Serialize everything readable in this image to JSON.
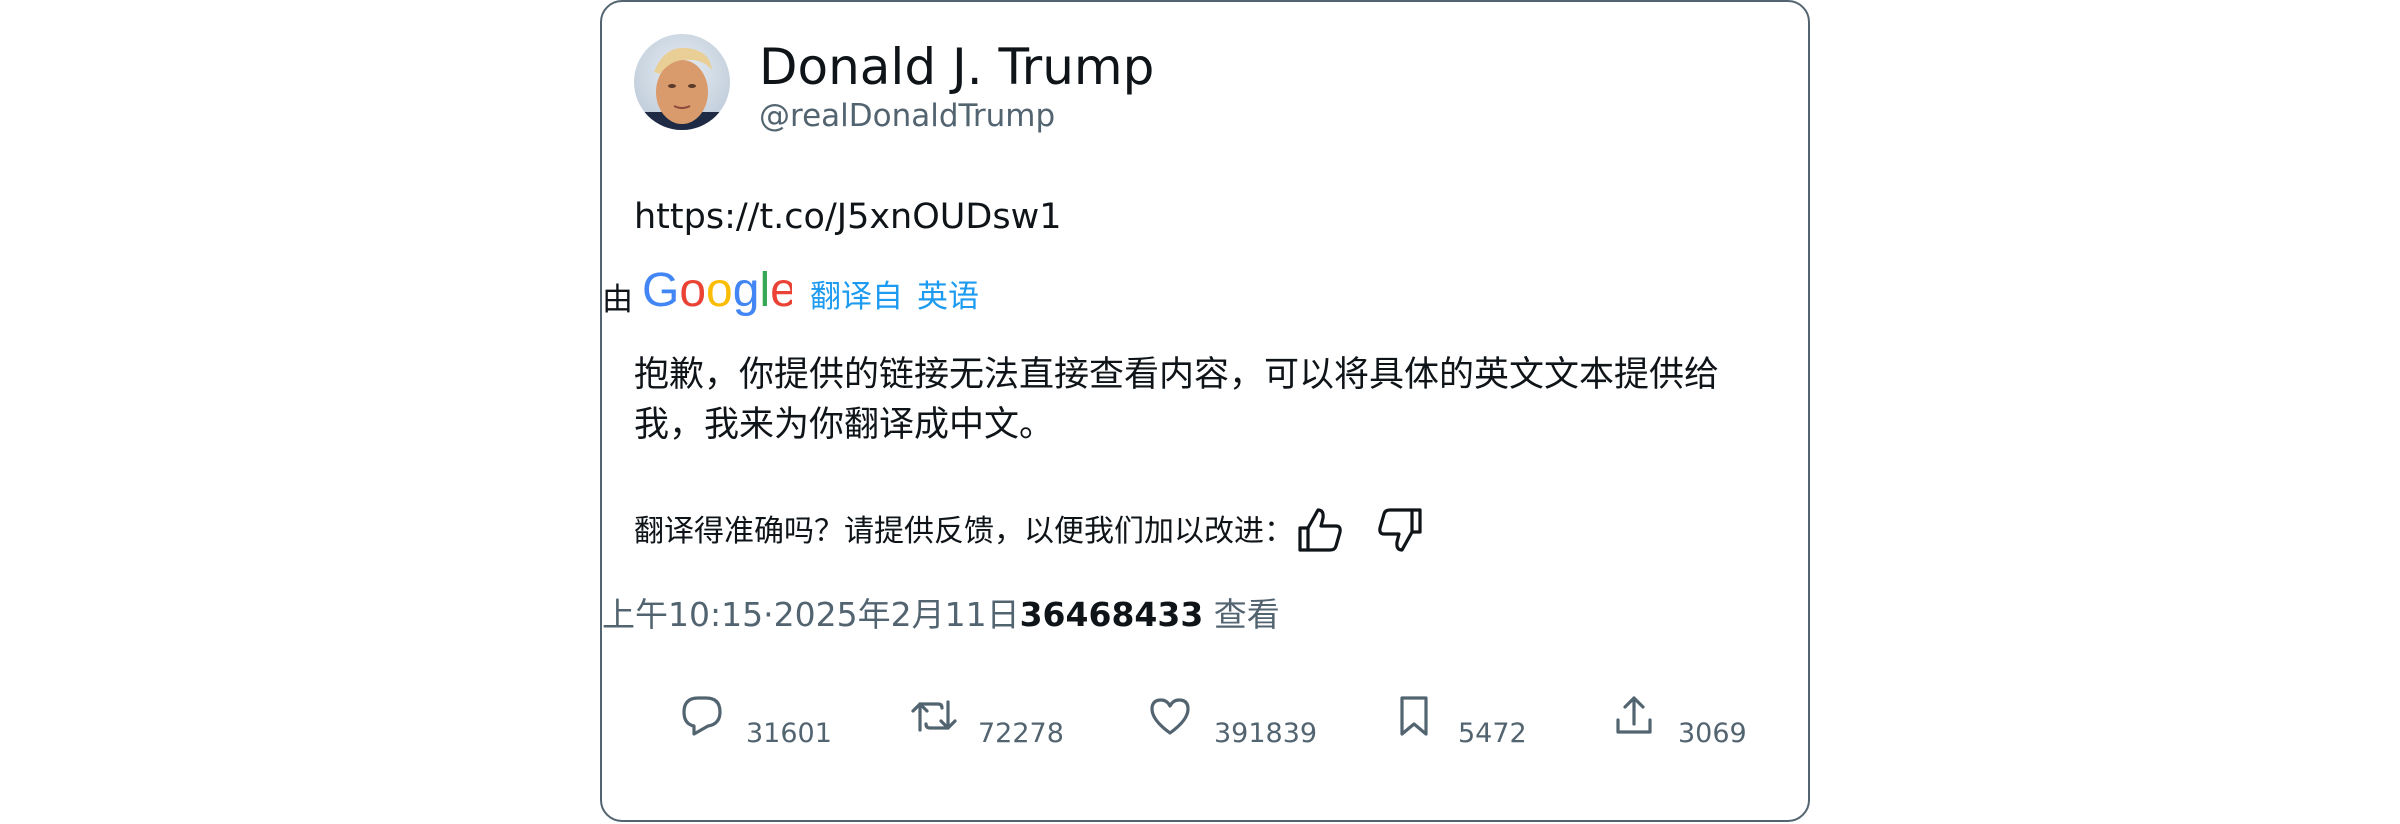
{
  "author": {
    "name": "Donald J. Trump",
    "handle": "@realDonaldTrump"
  },
  "tweet": {
    "link_text": "https://t.co/J5xnOUDsw1"
  },
  "translation_bar": {
    "by_label": "由",
    "provider_logo_text": "Google",
    "translated_from": "翻译自",
    "source_language": "英语"
  },
  "translation": {
    "text": "抱歉，你提供的链接无法直接查看内容，可以将具体的英文文本提供给我，我来为你翻译成中文。"
  },
  "feedback": {
    "prompt": "翻译得准确吗？请提供反馈，以便我们加以改进：",
    "thumbs_up_icon": "thumbs-up-icon",
    "thumbs_down_icon": "thumbs-down-icon"
  },
  "meta": {
    "time": "上午10:15",
    "separator": "·",
    "date": "2025年2月11日",
    "views_count": "36468433",
    "views_label": "查看"
  },
  "actions": {
    "reply_count": "31601",
    "retweet_count": "72278",
    "like_count": "391839",
    "bookmark_count": "5472",
    "share_count": "3069"
  },
  "colors": {
    "text_primary": "#0f1419",
    "text_secondary": "#536471",
    "link_blue": "#1d9bf0",
    "google_blue": "#4285f4",
    "google_red": "#ea4335",
    "google_yellow": "#fbbc05",
    "google_green": "#34a853"
  }
}
